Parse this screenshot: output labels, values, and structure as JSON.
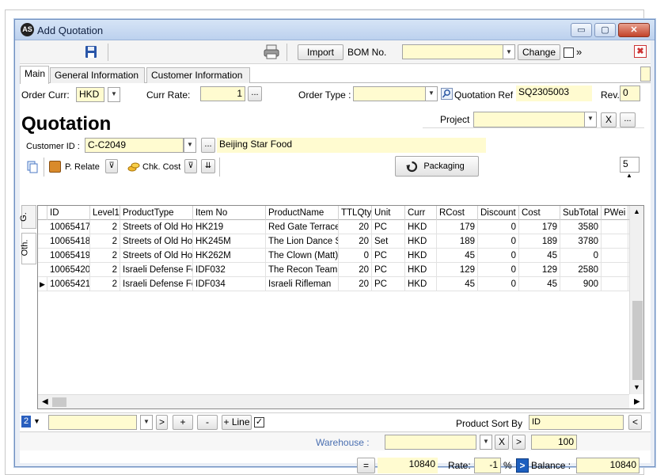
{
  "window": {
    "title": "Add Quotation",
    "minimize": "▭",
    "maximize": "▢",
    "close": "✕"
  },
  "toolbar": {
    "save_icon": "save-icon",
    "print_icon": "printer-icon",
    "import_label": "Import",
    "bom_label": "BOM No.",
    "bom_value": "",
    "change_label": "Change",
    "more_label": "»",
    "close_icon": "✖"
  },
  "tabs": [
    "Main",
    "General Information",
    "Customer Information"
  ],
  "order": {
    "curr_label": "Order Curr:",
    "curr_value": "HKD",
    "rate_label": "Curr Rate:",
    "rate_value": "1",
    "ellipsis": "...",
    "type_label": "Order Type :",
    "type_value": "",
    "quote_ref_label": "Quotation Ref",
    "quote_ref_value": "SQ2305003",
    "rev_label": "Rev.",
    "rev_value": "0"
  },
  "heading": "Quotation",
  "project": {
    "label": "Project",
    "value": "",
    "x": "X",
    "ellipsis": "..."
  },
  "customer": {
    "label": "Customer ID :",
    "id": "C-C2049",
    "ellipsis": "...",
    "name": "Beijing Star Food"
  },
  "toolbar2": {
    "prelate": "P. Relate",
    "chkcost": "Chk. Cost",
    "packaging": "Packaging",
    "count": "5"
  },
  "side_tabs": [
    "G.",
    "Oth."
  ],
  "grid": {
    "columns": [
      "ID",
      "Level1",
      "ProductType",
      "Item No",
      "ProductName",
      "TTLQty",
      "Unit",
      "Curr",
      "RCost",
      "Discount",
      "Cost",
      "SubTotal",
      "PWei"
    ],
    "rows": [
      [
        "10065417",
        "2",
        "Streets of Old Hon",
        "HK219",
        "Red Gate Terrace",
        "20",
        "PC",
        "HKD",
        "179",
        "0",
        "179",
        "3580",
        ""
      ],
      [
        "10065418",
        "2",
        "Streets of Old Hon",
        "HK245M",
        "The Lion Dance S",
        "20",
        "Set",
        "HKD",
        "189",
        "0",
        "189",
        "3780",
        ""
      ],
      [
        "10065419",
        "2",
        "Streets of Old Hon",
        "HK262M",
        "The Clown (Matt)",
        "0",
        "PC",
        "HKD",
        "45",
        "0",
        "45",
        "0",
        ""
      ],
      [
        "10065420",
        "2",
        "Israeli Defense For",
        "IDF032",
        "The Recon Team",
        "20",
        "PC",
        "HKD",
        "129",
        "0",
        "129",
        "2580",
        ""
      ],
      [
        "10065421",
        "2",
        "Israeli Defense For",
        "IDF034",
        "Israeli Rifleman",
        "20",
        "PC",
        "HKD",
        "45",
        "0",
        "45",
        "900",
        ""
      ]
    ],
    "current_row_marker": "▶"
  },
  "bottom": {
    "level_value": "2",
    "filter_value": "",
    "next": ">",
    "plus": "+",
    "minus": "-",
    "add_line": "+ Line",
    "sort_label": "Product Sort By",
    "sort_value": "ID",
    "sort_arrow": "<",
    "warehouse_label": "Warehouse :",
    "warehouse_value": "",
    "warehouse_x": "X",
    "warehouse_next": ">",
    "warehouse_qty": "100",
    "equals": "=",
    "total": "10840",
    "rate_label": "Rate:",
    "rate_value": "-1",
    "percent": "%",
    "balance_arrow": ">",
    "balance_label": "Balance :",
    "balance_value": "10840"
  },
  "colors": {
    "input_bg": "#fffbd0",
    "accent": "#3a6fc6",
    "warehouse_label": "#4a6fb0"
  }
}
